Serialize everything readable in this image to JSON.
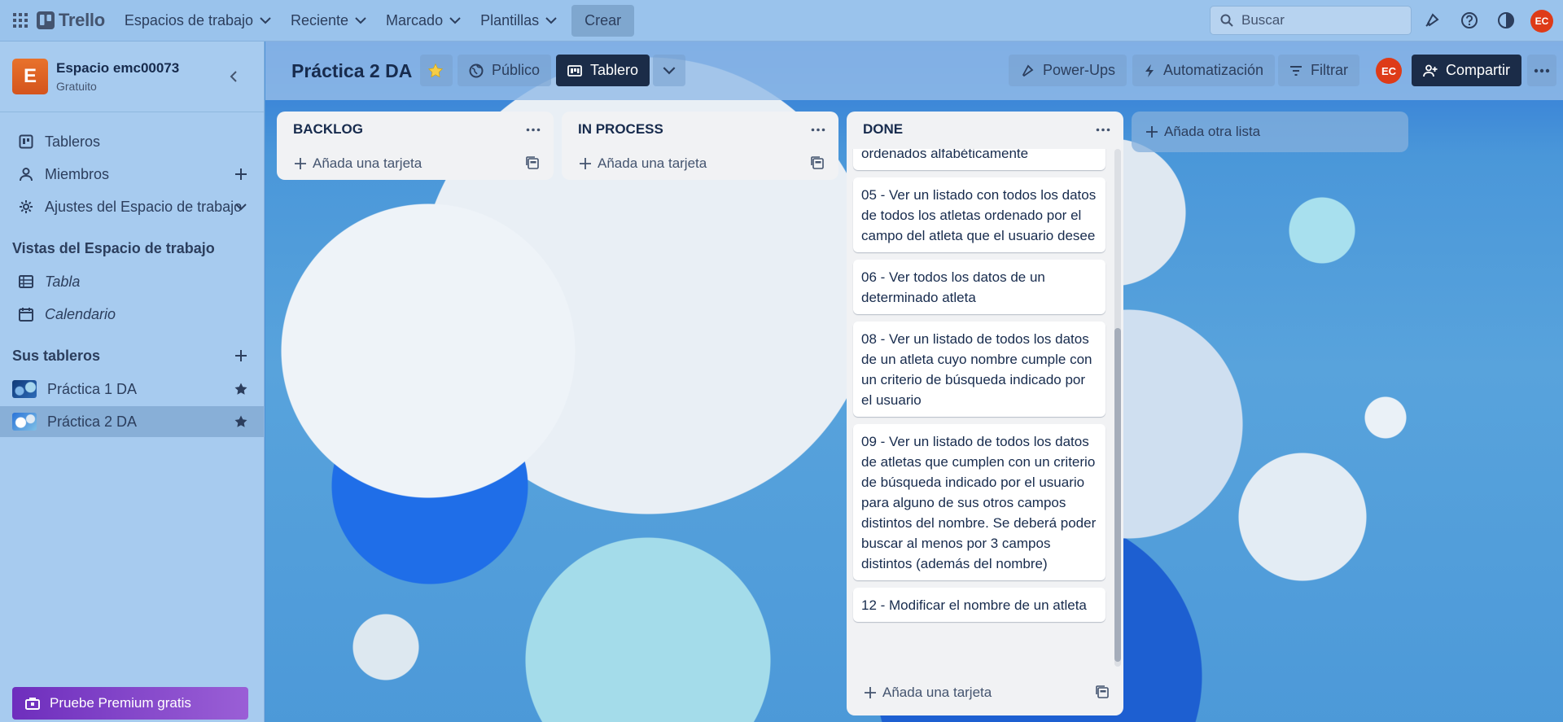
{
  "topbar": {
    "app_name": "Trello",
    "nav": [
      {
        "label": "Espacios de trabajo"
      },
      {
        "label": "Reciente"
      },
      {
        "label": "Marcado"
      },
      {
        "label": "Plantillas"
      }
    ],
    "create_label": "Crear",
    "search_placeholder": "Buscar",
    "user_initials": "EC"
  },
  "sidebar": {
    "workspace_initial": "E",
    "workspace_name": "Espacio emc00073",
    "workspace_plan": "Gratuito",
    "items": [
      {
        "label": "Tableros",
        "icon": "board-icon"
      },
      {
        "label": "Miembros",
        "icon": "person-icon"
      },
      {
        "label": "Ajustes del Espacio de trabajo",
        "icon": "gear-icon"
      }
    ],
    "views_heading": "Vistas del Espacio de trabajo",
    "views": [
      {
        "label": "Tabla",
        "icon": "table-icon"
      },
      {
        "label": "Calendario",
        "icon": "calendar-icon"
      }
    ],
    "boards_heading": "Sus tableros",
    "boards": [
      {
        "label": "Práctica 1 DA"
      },
      {
        "label": "Práctica 2 DA"
      }
    ],
    "premium_label": "Pruebe Premium gratis"
  },
  "board": {
    "title": "Práctica 2 DA",
    "visibility_label": "Público",
    "view_label": "Tablero",
    "powerups_label": "Power-Ups",
    "automation_label": "Automatización",
    "filter_label": "Filtrar",
    "member_initials": "EC",
    "share_label": "Compartir",
    "add_list_label": "Añada otra lista",
    "lists": [
      {
        "title": "BACKLOG",
        "add_card_label": "Añada una tarjeta",
        "cards": []
      },
      {
        "title": "IN PROCESS",
        "add_card_label": "Añada una tarjeta",
        "cards": []
      },
      {
        "title": "DONE",
        "add_card_label": "Añada una tarjeta",
        "partial_card": "ordenados alfabéticamente",
        "cards": [
          "05 - Ver un listado con todos los datos de todos los atletas ordenado por el campo del atleta que el usuario desee",
          "06 - Ver todos los datos de un determinado atleta",
          "08 - Ver un listado de todos los datos de un atleta cuyo nombre cumple con un criterio de búsqueda indicado por el usuario",
          "09 - Ver un listado de todos los datos de atletas que cumplen con un criterio de búsqueda indicado por el usuario para alguno de sus otros campos distintos del nombre. Se deberá poder buscar al menos por 3 campos distintos (además del nombre)",
          "12 - Modificar el nombre de un atleta"
        ]
      }
    ]
  },
  "colors": {
    "topbar_bg": "#9ac3ec",
    "sidebar_bg": "#a7cbef",
    "workspace_badge": "#e0622a",
    "share_bg": "#1b2c48",
    "avatar": "#de3b18",
    "premium": "#7d3fc9",
    "star": "#f5cd47"
  }
}
